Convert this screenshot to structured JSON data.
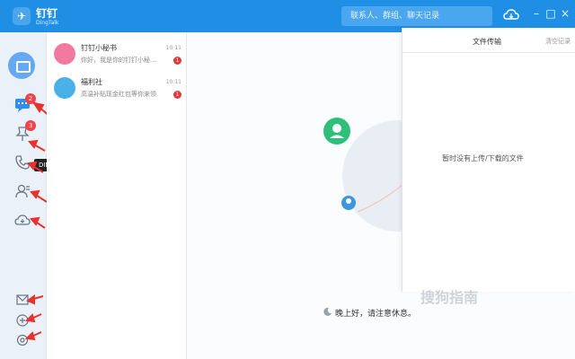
{
  "titlebar": {
    "app_name": "钉钉",
    "app_sub": "DingTalk",
    "search_placeholder": "联系人、群组、聊天记录"
  },
  "nav": {
    "chat_badge": "2",
    "ding_badge": "3",
    "tooltip": "DING"
  },
  "chats": [
    {
      "name": "钉钉小秘书",
      "time": "10:11",
      "msg": "你好，我是你的钉钉小秘...",
      "unread": "1"
    },
    {
      "name": "福利社",
      "time": "10:11",
      "msg": "高温补贴现金红包等你来领",
      "unread": "1"
    }
  ],
  "main": {
    "greeting": "晚上好，请注意休息。"
  },
  "panel": {
    "title": "文件传输",
    "clear": "清空记录",
    "empty": "暂时没有上传/下载的文件"
  },
  "watermark": "搜狗指南"
}
